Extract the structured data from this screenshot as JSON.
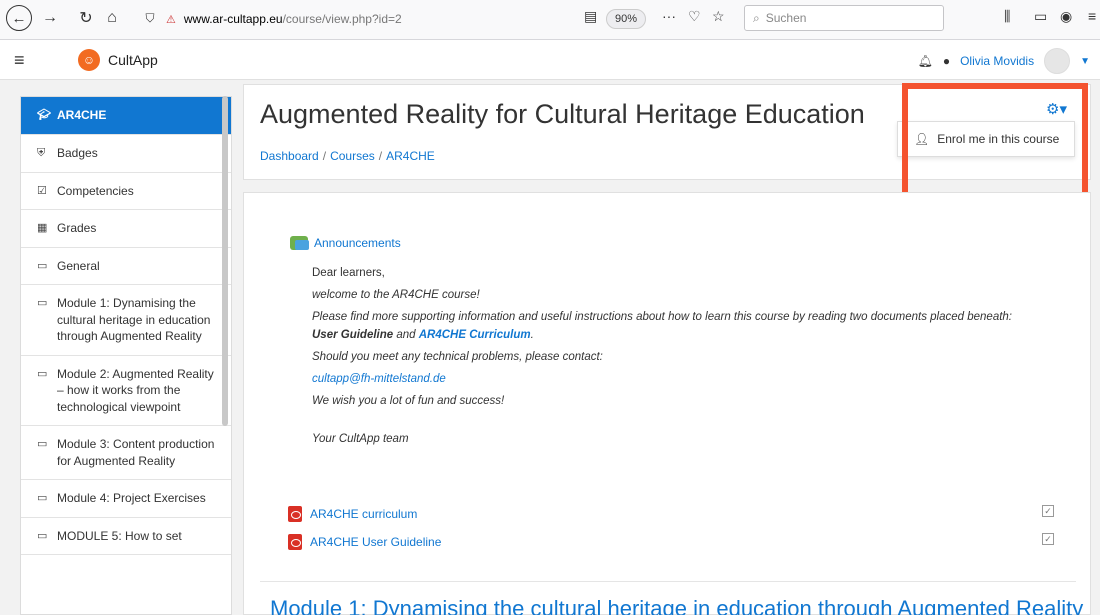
{
  "browser": {
    "url_domain": "www.ar-cultapp.eu",
    "url_path": "/course/view.php?id=2",
    "zoom": "90%",
    "search_placeholder": "Suchen"
  },
  "navbar": {
    "brand": "CultApp",
    "user_name": "Olivia Movidis"
  },
  "sidebar": {
    "items": [
      {
        "label": "AR4CHE",
        "icon": "graduation-cap-icon"
      },
      {
        "label": "Badges",
        "icon": "shield-icon"
      },
      {
        "label": "Competencies",
        "icon": "checkbox-icon"
      },
      {
        "label": "Grades",
        "icon": "table-icon"
      },
      {
        "label": "General",
        "icon": "folder-icon"
      },
      {
        "label": "Module 1: Dynamising the cultural heritage in education through Augmented Reality",
        "icon": "folder-icon"
      },
      {
        "label": "Module 2: Augmented Reality – how it works from the technological viewpoint",
        "icon": "folder-icon"
      },
      {
        "label": "Module 3: Content production for Augmented Reality",
        "icon": "folder-icon"
      },
      {
        "label": "Module 4: Project Exercises",
        "icon": "folder-icon"
      },
      {
        "label": "MODULE 5: How to set",
        "icon": "folder-icon"
      }
    ]
  },
  "header": {
    "title": "Augmented Reality for Cultural Heritage Education",
    "breadcrumb": [
      "Dashboard",
      "Courses",
      "AR4CHE"
    ]
  },
  "menu": {
    "enrol": "Enrol me in this course"
  },
  "content": {
    "announcements": "Announcements",
    "greeting": "Dear learners,",
    "welcome": "welcome to the AR4CHE course!",
    "info_prefix": "Please find more supporting information and useful instructions about how to learn this course by reading two documents placed beneath: ",
    "info_doc1": "User Guideline",
    "info_and": " and ",
    "info_doc2": "AR4CHE Curriculum",
    "info_end": ".",
    "contact": "Should you meet any technical problems, please contact:",
    "email": "cultapp@fh-mittelstand.de",
    "wish": "We wish you a lot of fun and success!",
    "signature": "Your CultApp team",
    "resources": [
      "AR4CHE curriculum",
      "AR4CHE User Guideline"
    ],
    "module_heading": "Module 1: Dynamising the cultural heritage in education through Augmented Reality"
  },
  "colors": {
    "accent": "#1177d1",
    "highlight": "#f4532f",
    "brand": "#f26b21"
  }
}
